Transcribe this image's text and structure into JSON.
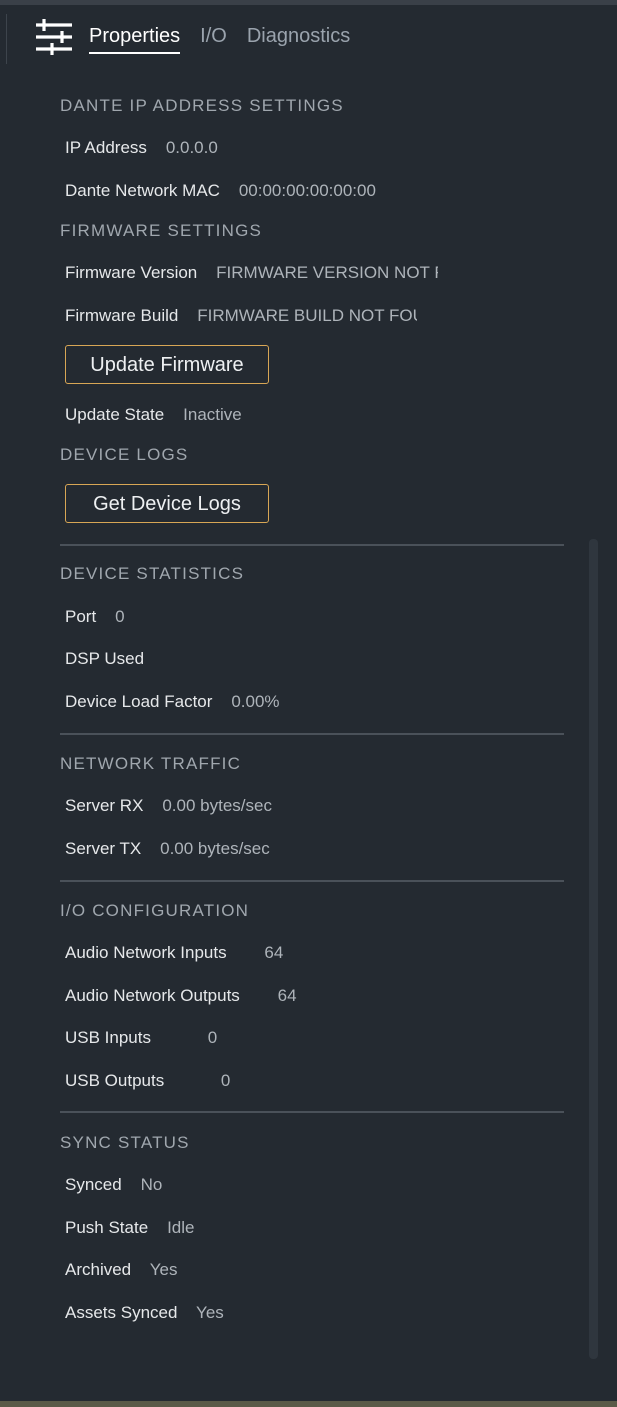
{
  "tabs": [
    {
      "label": "Properties"
    },
    {
      "label": "I/O"
    },
    {
      "label": "Diagnostics"
    }
  ],
  "tab_icon": "sliders-icon",
  "sections": {
    "dante": {
      "title": "DANTE IP ADDRESS SETTINGS",
      "ip_label": "IP Address",
      "ip_value": "0.0.0.0",
      "mac_label": "Dante Network MAC",
      "mac_value": "00:00:00:00:00:00"
    },
    "firmware": {
      "title": "FIRMWARE SETTINGS",
      "version_label": "Firmware Version",
      "version_value": "FIRMWARE VERSION NOT FOUND",
      "build_label": "Firmware Build",
      "build_value": "FIRMWARE BUILD NOT FOUND",
      "update_button": "Update Firmware",
      "state_label": "Update State",
      "state_value": "Inactive"
    },
    "logs": {
      "title": "DEVICE LOGS",
      "button": "Get Device Logs"
    },
    "stats": {
      "title": "DEVICE STATISTICS",
      "port_label": "Port",
      "port_value": "0",
      "dsp_label": "DSP Used",
      "dsp_value": "",
      "load_label": "Device Load Factor",
      "load_value": "0.00%"
    },
    "traffic": {
      "title": "NETWORK TRAFFIC",
      "rx_label": "Server RX",
      "rx_value": "0.00 bytes/sec",
      "tx_label": "Server TX",
      "tx_value": "0.00 bytes/sec"
    },
    "io": {
      "title": "I/O CONFIGURATION",
      "ani_label": "Audio Network Inputs",
      "ani_value": "64",
      "ano_label": "Audio Network Outputs",
      "ano_value": "64",
      "usbi_label": "USB Inputs",
      "usbi_value": "0",
      "usbo_label": "USB Outputs",
      "usbo_value": "0"
    },
    "sync": {
      "title": "SYNC STATUS",
      "synced_label": "Synced",
      "synced_value": "No",
      "push_label": "Push State",
      "push_value": "Idle",
      "archived_label": "Archived",
      "archived_value": "Yes",
      "assets_label": "Assets Synced",
      "assets_value": "Yes"
    }
  },
  "colors": {
    "panel_bg": "#242a31",
    "button_border": "#d8a655",
    "label": "#e6e8ea",
    "value": "#aeb4ba",
    "section_title": "#a0a7ae"
  }
}
